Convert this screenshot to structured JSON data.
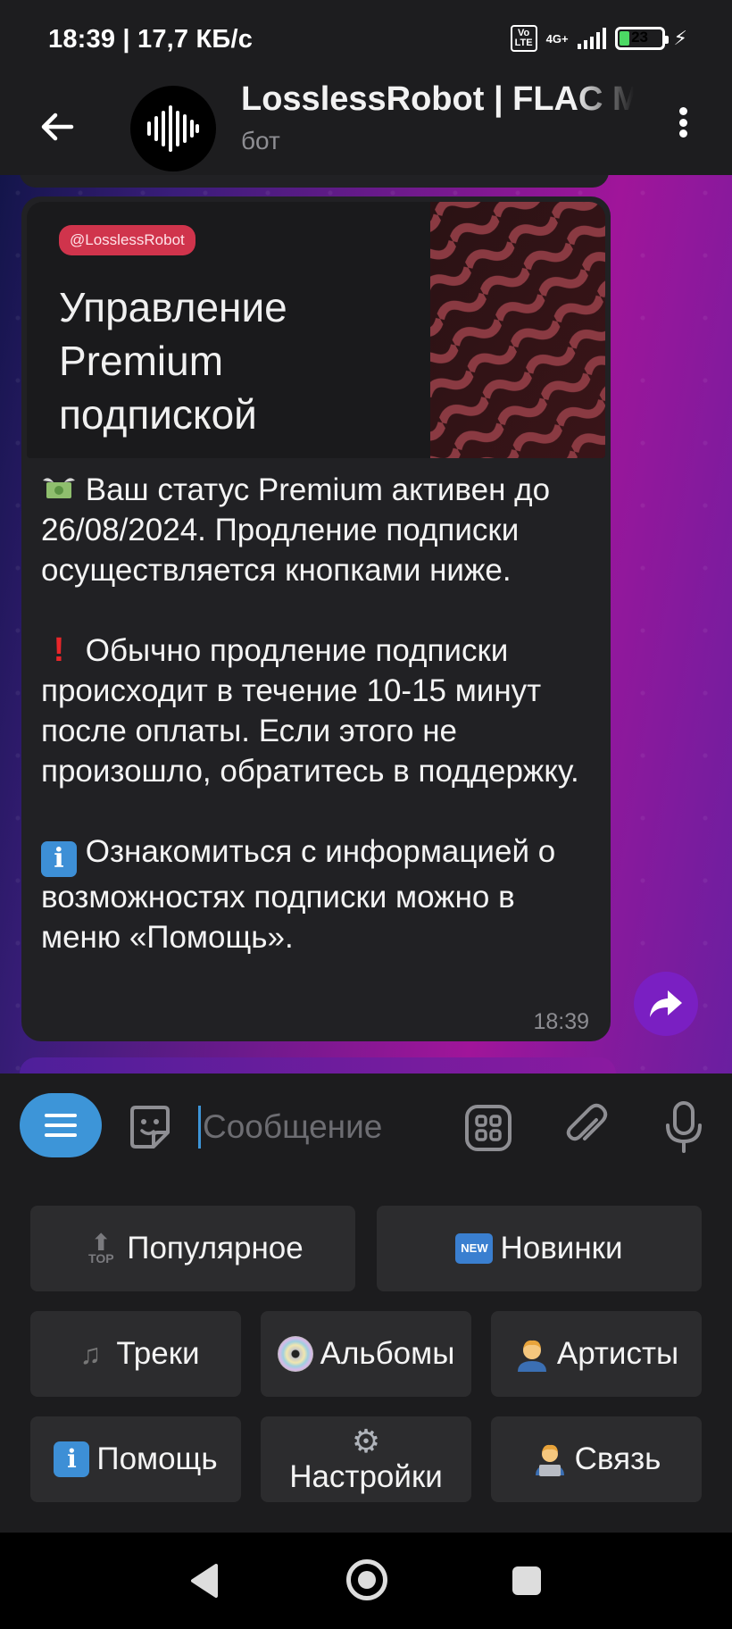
{
  "status_bar": {
    "time_speed": "18:39 | 17,7 КБ/с",
    "volte": "Vo LTE",
    "network": "4G+",
    "battery": "23",
    "battery_level": 0.23
  },
  "header": {
    "title": "LosslessRobot | FLAC M",
    "subtitle": "бот"
  },
  "message": {
    "banner_tag": "@LosslessRobot",
    "banner_title": "Управление Premium подпиской",
    "paragraphs": [
      "Ваш статус Premium активен до 26/08/2024. Продление подписки осуществляется кнопками ниже.",
      "Обычно продление подписки происходит в течение 10-15 минут после оплаты. Если этого не произошло, обратитесь в поддержку.",
      "Ознакомиться с информацией о возможностях подписки можно в меню «Помощь»."
    ],
    "time": "18:39"
  },
  "input": {
    "placeholder": "Сообщение"
  },
  "keyboard": {
    "popular": "Популярное",
    "new": "Новинки",
    "new_badge": "NEW",
    "top_badge": "TOP",
    "tracks": "Треки",
    "albums": "Альбомы",
    "artists": "Артисты",
    "help": "Помощь",
    "settings": "Настройки",
    "contact": "Связь"
  },
  "colors": {
    "accent": "#3d95d8",
    "bubble": "#212124",
    "tag": "#d0344c",
    "share": "#7a1fc2"
  }
}
